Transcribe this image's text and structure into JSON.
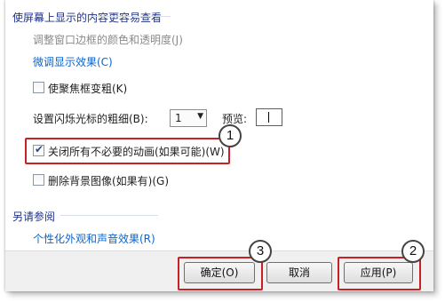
{
  "section": {
    "header": "使屏幕上显示的内容更容易查看",
    "adjust_border_link": "调整窗口边框的颜色和透明度(J)",
    "fine_tune_link": "微调显示效果(C)"
  },
  "options": {
    "thicker_focus": {
      "label": "使聚焦框变粗(K)",
      "checked": false
    },
    "cursor_thickness": {
      "label": "设置闪烁光标的粗细(B):",
      "value": "1",
      "preview_label": "预览:"
    },
    "turn_off_animations": {
      "label": "关闭所有不必要的动画(如果可能)(W)",
      "checked": true
    },
    "remove_background": {
      "label": "删除背景图像(如果有)(G)",
      "checked": false
    }
  },
  "see_also": {
    "header": "另请参阅",
    "personalize_link": "个性化外观和声音效果(R)"
  },
  "buttons": {
    "ok": "确定(O)",
    "cancel": "取消",
    "apply": "应用(P)"
  },
  "callouts": [
    "1",
    "2",
    "3"
  ],
  "colors": {
    "link": "#0a66cc",
    "header": "#1e3287",
    "highlight": "#c82024"
  }
}
